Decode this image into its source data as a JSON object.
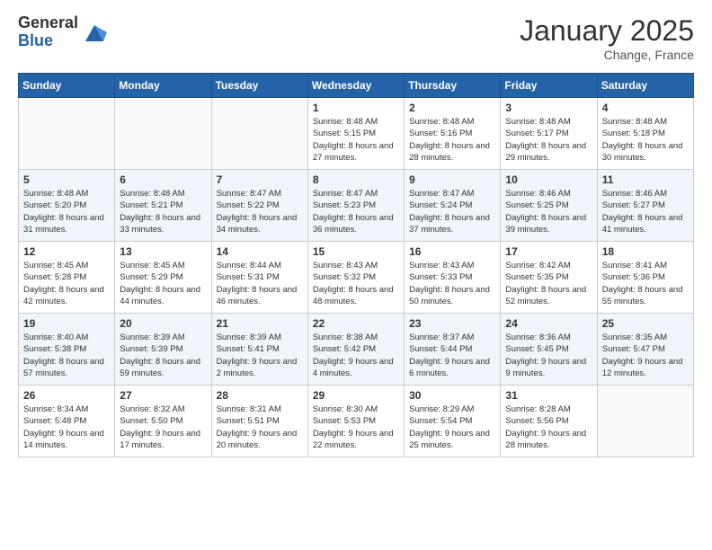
{
  "logo": {
    "general": "General",
    "blue": "Blue"
  },
  "header": {
    "month": "January 2025",
    "location": "Change, France"
  },
  "days_of_week": [
    "Sunday",
    "Monday",
    "Tuesday",
    "Wednesday",
    "Thursday",
    "Friday",
    "Saturday"
  ],
  "weeks": [
    [
      {
        "day": "",
        "sunrise": "",
        "sunset": "",
        "daylight": ""
      },
      {
        "day": "",
        "sunrise": "",
        "sunset": "",
        "daylight": ""
      },
      {
        "day": "",
        "sunrise": "",
        "sunset": "",
        "daylight": ""
      },
      {
        "day": "1",
        "sunrise": "Sunrise: 8:48 AM",
        "sunset": "Sunset: 5:15 PM",
        "daylight": "Daylight: 8 hours and 27 minutes."
      },
      {
        "day": "2",
        "sunrise": "Sunrise: 8:48 AM",
        "sunset": "Sunset: 5:16 PM",
        "daylight": "Daylight: 8 hours and 28 minutes."
      },
      {
        "day": "3",
        "sunrise": "Sunrise: 8:48 AM",
        "sunset": "Sunset: 5:17 PM",
        "daylight": "Daylight: 8 hours and 29 minutes."
      },
      {
        "day": "4",
        "sunrise": "Sunrise: 8:48 AM",
        "sunset": "Sunset: 5:18 PM",
        "daylight": "Daylight: 8 hours and 30 minutes."
      }
    ],
    [
      {
        "day": "5",
        "sunrise": "Sunrise: 8:48 AM",
        "sunset": "Sunset: 5:20 PM",
        "daylight": "Daylight: 8 hours and 31 minutes."
      },
      {
        "day": "6",
        "sunrise": "Sunrise: 8:48 AM",
        "sunset": "Sunset: 5:21 PM",
        "daylight": "Daylight: 8 hours and 33 minutes."
      },
      {
        "day": "7",
        "sunrise": "Sunrise: 8:47 AM",
        "sunset": "Sunset: 5:22 PM",
        "daylight": "Daylight: 8 hours and 34 minutes."
      },
      {
        "day": "8",
        "sunrise": "Sunrise: 8:47 AM",
        "sunset": "Sunset: 5:23 PM",
        "daylight": "Daylight: 8 hours and 36 minutes."
      },
      {
        "day": "9",
        "sunrise": "Sunrise: 8:47 AM",
        "sunset": "Sunset: 5:24 PM",
        "daylight": "Daylight: 8 hours and 37 minutes."
      },
      {
        "day": "10",
        "sunrise": "Sunrise: 8:46 AM",
        "sunset": "Sunset: 5:25 PM",
        "daylight": "Daylight: 8 hours and 39 minutes."
      },
      {
        "day": "11",
        "sunrise": "Sunrise: 8:46 AM",
        "sunset": "Sunset: 5:27 PM",
        "daylight": "Daylight: 8 hours and 41 minutes."
      }
    ],
    [
      {
        "day": "12",
        "sunrise": "Sunrise: 8:45 AM",
        "sunset": "Sunset: 5:28 PM",
        "daylight": "Daylight: 8 hours and 42 minutes."
      },
      {
        "day": "13",
        "sunrise": "Sunrise: 8:45 AM",
        "sunset": "Sunset: 5:29 PM",
        "daylight": "Daylight: 8 hours and 44 minutes."
      },
      {
        "day": "14",
        "sunrise": "Sunrise: 8:44 AM",
        "sunset": "Sunset: 5:31 PM",
        "daylight": "Daylight: 8 hours and 46 minutes."
      },
      {
        "day": "15",
        "sunrise": "Sunrise: 8:43 AM",
        "sunset": "Sunset: 5:32 PM",
        "daylight": "Daylight: 8 hours and 48 minutes."
      },
      {
        "day": "16",
        "sunrise": "Sunrise: 8:43 AM",
        "sunset": "Sunset: 5:33 PM",
        "daylight": "Daylight: 8 hours and 50 minutes."
      },
      {
        "day": "17",
        "sunrise": "Sunrise: 8:42 AM",
        "sunset": "Sunset: 5:35 PM",
        "daylight": "Daylight: 8 hours and 52 minutes."
      },
      {
        "day": "18",
        "sunrise": "Sunrise: 8:41 AM",
        "sunset": "Sunset: 5:36 PM",
        "daylight": "Daylight: 8 hours and 55 minutes."
      }
    ],
    [
      {
        "day": "19",
        "sunrise": "Sunrise: 8:40 AM",
        "sunset": "Sunset: 5:38 PM",
        "daylight": "Daylight: 8 hours and 57 minutes."
      },
      {
        "day": "20",
        "sunrise": "Sunrise: 8:39 AM",
        "sunset": "Sunset: 5:39 PM",
        "daylight": "Daylight: 8 hours and 59 minutes."
      },
      {
        "day": "21",
        "sunrise": "Sunrise: 8:39 AM",
        "sunset": "Sunset: 5:41 PM",
        "daylight": "Daylight: 9 hours and 2 minutes."
      },
      {
        "day": "22",
        "sunrise": "Sunrise: 8:38 AM",
        "sunset": "Sunset: 5:42 PM",
        "daylight": "Daylight: 9 hours and 4 minutes."
      },
      {
        "day": "23",
        "sunrise": "Sunrise: 8:37 AM",
        "sunset": "Sunset: 5:44 PM",
        "daylight": "Daylight: 9 hours and 6 minutes."
      },
      {
        "day": "24",
        "sunrise": "Sunrise: 8:36 AM",
        "sunset": "Sunset: 5:45 PM",
        "daylight": "Daylight: 9 hours and 9 minutes."
      },
      {
        "day": "25",
        "sunrise": "Sunrise: 8:35 AM",
        "sunset": "Sunset: 5:47 PM",
        "daylight": "Daylight: 9 hours and 12 minutes."
      }
    ],
    [
      {
        "day": "26",
        "sunrise": "Sunrise: 8:34 AM",
        "sunset": "Sunset: 5:48 PM",
        "daylight": "Daylight: 9 hours and 14 minutes."
      },
      {
        "day": "27",
        "sunrise": "Sunrise: 8:32 AM",
        "sunset": "Sunset: 5:50 PM",
        "daylight": "Daylight: 9 hours and 17 minutes."
      },
      {
        "day": "28",
        "sunrise": "Sunrise: 8:31 AM",
        "sunset": "Sunset: 5:51 PM",
        "daylight": "Daylight: 9 hours and 20 minutes."
      },
      {
        "day": "29",
        "sunrise": "Sunrise: 8:30 AM",
        "sunset": "Sunset: 5:53 PM",
        "daylight": "Daylight: 9 hours and 22 minutes."
      },
      {
        "day": "30",
        "sunrise": "Sunrise: 8:29 AM",
        "sunset": "Sunset: 5:54 PM",
        "daylight": "Daylight: 9 hours and 25 minutes."
      },
      {
        "day": "31",
        "sunrise": "Sunrise: 8:28 AM",
        "sunset": "Sunset: 5:56 PM",
        "daylight": "Daylight: 9 hours and 28 minutes."
      },
      {
        "day": "",
        "sunrise": "",
        "sunset": "",
        "daylight": ""
      }
    ]
  ]
}
